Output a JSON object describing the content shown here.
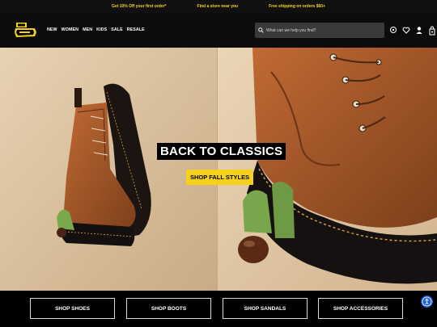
{
  "promo": {
    "items": [
      "Get 10% Off your first order*",
      "Find a store near you",
      "Free shipping on orders $60+"
    ]
  },
  "header": {
    "logo_text": "Dr. Martens",
    "nav": [
      "NEW",
      "WOMEN",
      "MEN",
      "KIDS",
      "SALE",
      "RESALE"
    ],
    "search_placeholder": "What can we help you find?"
  },
  "hero": {
    "title": "BACK TO CLASSICS",
    "cta": "SHOP FALL STYLES"
  },
  "categories": [
    "SHOP SHOES",
    "SHOP BOOTS",
    "SHOP SANDALS",
    "SHOP ACCESSORIES"
  ],
  "colors": {
    "accent_yellow": "#f5d11c",
    "header_bg": "#0c0c0c",
    "boot_brown": "#a4592a"
  }
}
